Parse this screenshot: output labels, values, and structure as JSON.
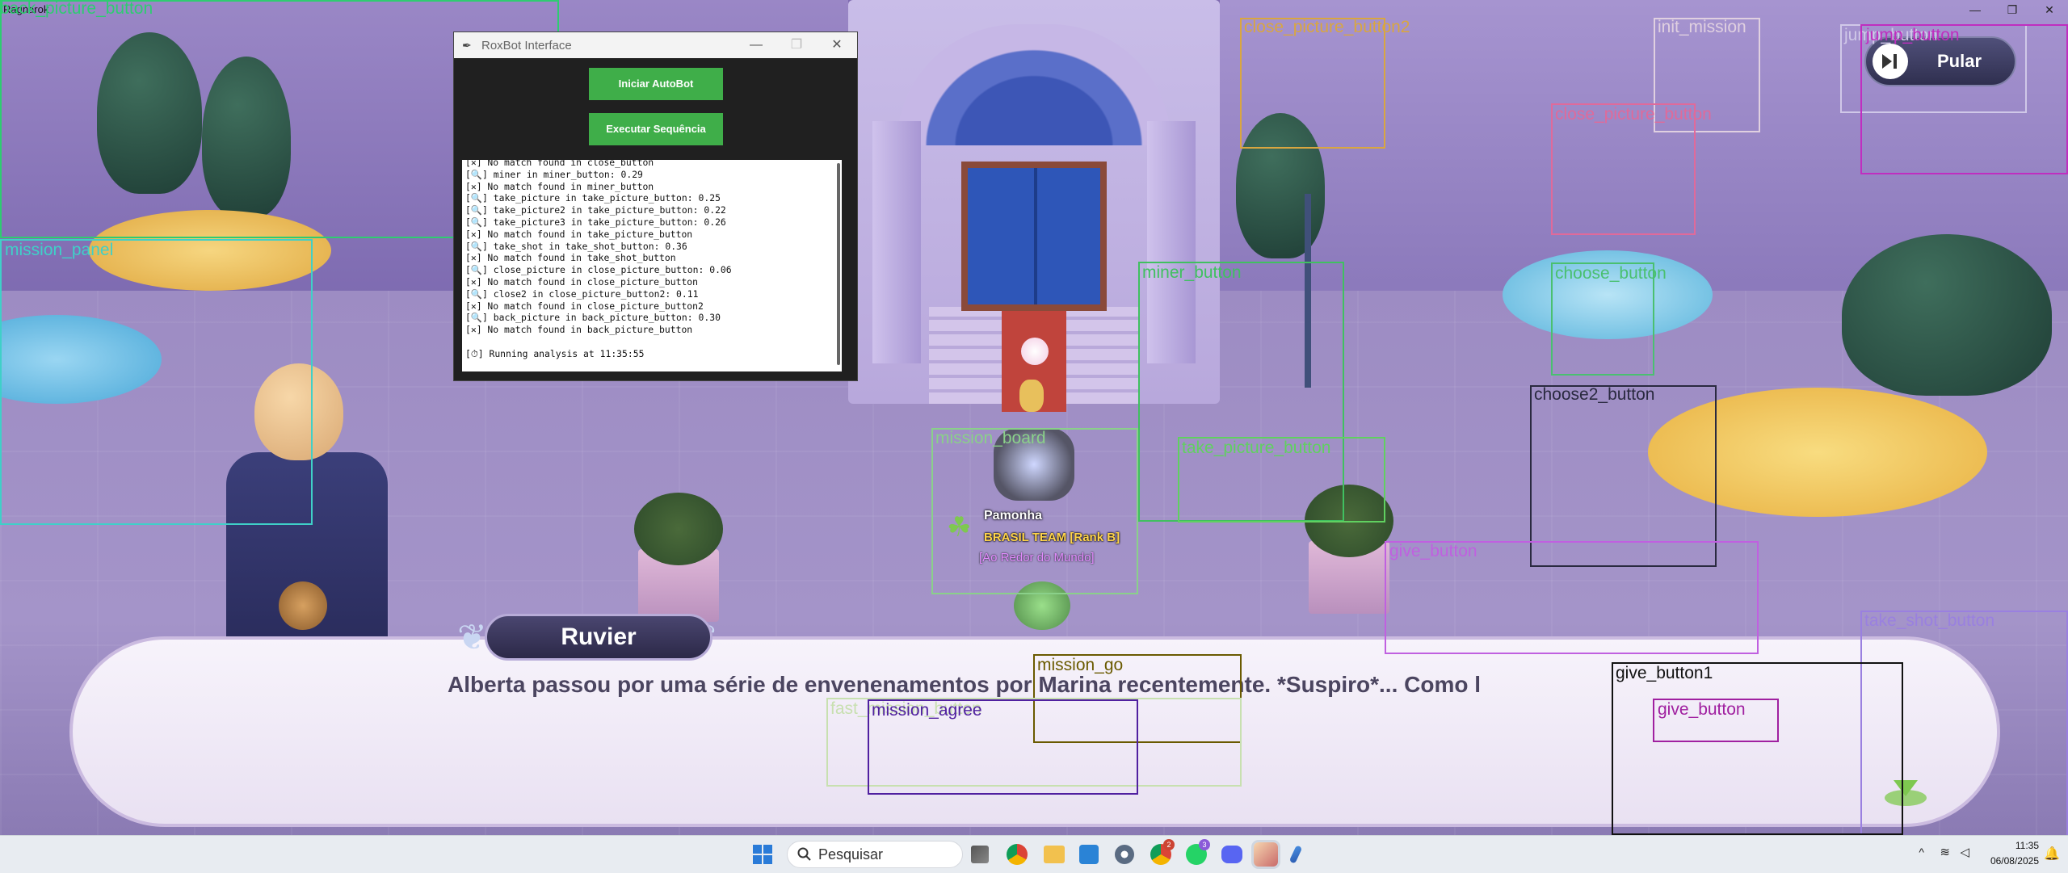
{
  "window": {
    "caption": "Ragnarok",
    "minimize": "—",
    "maximize": "❐",
    "close": "✕"
  },
  "game": {
    "skip_button_label": "Pular",
    "speaker_name": "Ruvier",
    "dialog_text": "Alberta passou por uma série de envenenamentos por Marina recentemente. *Suspiro*... Como l",
    "player": {
      "name": "Pamonha",
      "guild": "BRASIL TEAM [Rank B]",
      "title": "[Ao Redor do Mundo]"
    }
  },
  "roxbot": {
    "title": "RoxBot Interface",
    "start_button": "Iniciar AutoBot",
    "sequence_button": "Executar Sequência",
    "log_lines": [
      "[✕] No match found in close_button",
      "[🔍] miner in miner_button: 0.29",
      "[✕] No match found in miner_button",
      "[🔍] take_picture in take_picture_button: 0.25",
      "[🔍] take_picture2 in take_picture_button: 0.22",
      "[🔍] take_picture3 in take_picture_button: 0.26",
      "[✕] No match found in take_picture_button",
      "[🔍] take_shot in take_shot_button: 0.36",
      "[✕] No match found in take_shot_button",
      "[🔍] close_picture in close_picture_button: 0.06",
      "[✕] No match found in close_picture_button",
      "[🔍] close2 in close_picture_button2: 0.11",
      "[✕] No match found in close_picture_button2",
      "[🔍] back_picture in back_picture_button: 0.30",
      "[✕] No match found in back_picture_button",
      "",
      "[⏱] Running analysis at 11:35:55"
    ]
  },
  "detections": [
    {
      "label": "back_picture_button",
      "color": "#2ecc71"
    },
    {
      "label": "mission_panel",
      "color": "#3fd0c8"
    },
    {
      "label": "close_picture_button2",
      "color": "#d9a640"
    },
    {
      "label": "init_mission",
      "color": "#e0d0e0"
    },
    {
      "label": "jump_button",
      "color": "#d0c8e8"
    },
    {
      "label": "jump_button",
      "color": "#c02ec0"
    },
    {
      "label": "close_picture_button",
      "color": "#e06a9a"
    },
    {
      "label": "miner_button",
      "color": "#40c060"
    },
    {
      "label": "choose_button",
      "color": "#4ac070"
    },
    {
      "label": "choose2_button",
      "color": "#2a2a40"
    },
    {
      "label": "mission_board",
      "color": "#8ad08a"
    },
    {
      "label": "take_picture_button",
      "color": "#60d060"
    },
    {
      "label": "give_button",
      "color": "#c060e0"
    },
    {
      "label": "take_shot_button",
      "color": "#9a80e0"
    },
    {
      "label": "mission_go",
      "color": "#6a5a00"
    },
    {
      "label": "fast_mission_button",
      "color": "#c8e0b0"
    },
    {
      "label": "mission_agree",
      "color": "#5020a0"
    },
    {
      "label": "give_button1",
      "color": "#111111"
    },
    {
      "label": "give_button",
      "color": "#a020a0"
    }
  ],
  "taskbar": {
    "search_placeholder": "Pesquisar",
    "time": "11:35",
    "date": "06/08/2025",
    "badges": {
      "chrome_alt": "2",
      "whatsapp": "3"
    }
  }
}
